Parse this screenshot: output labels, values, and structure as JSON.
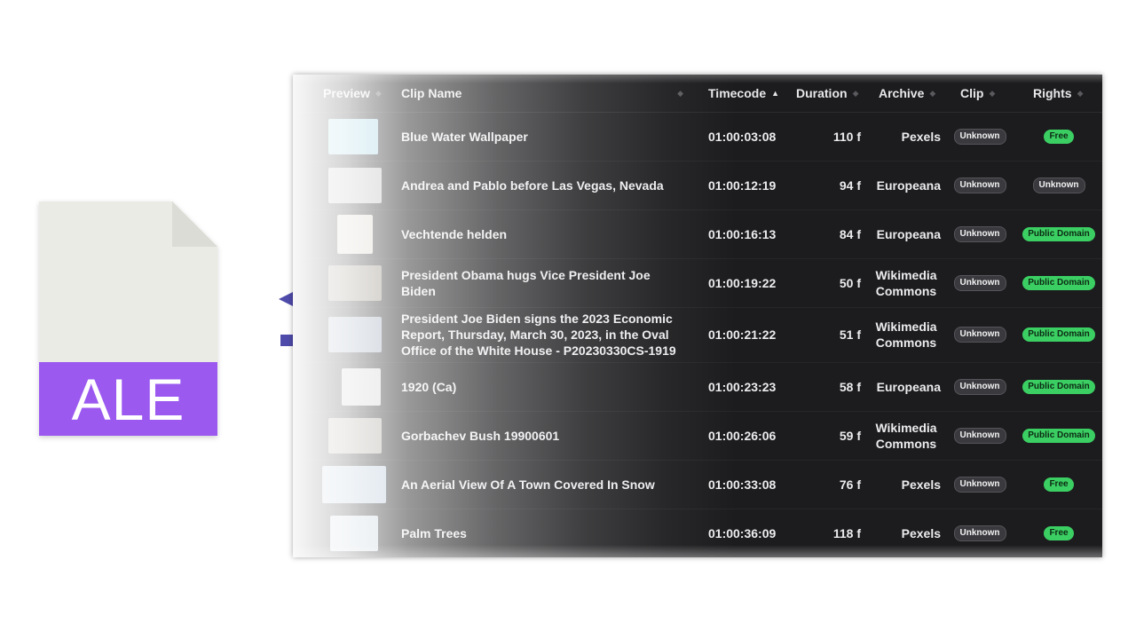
{
  "file_icon": {
    "label": "ALE",
    "body_color": "#ebebe6",
    "fold_color": "#dcdcd6",
    "band_color": "#9b59f0"
  },
  "arrows": {
    "color": "#4f4bab",
    "left": "arrow-left-icon",
    "right": "arrow-right-icon"
  },
  "table": {
    "columns": [
      {
        "label": "Preview",
        "sort": "none"
      },
      {
        "label": "Clip Name",
        "sort": "none"
      },
      {
        "label": "Timecode",
        "sort": "asc"
      },
      {
        "label": "Duration",
        "sort": "none"
      },
      {
        "label": "Archive",
        "sort": "none"
      },
      {
        "label": "Clip",
        "sort": "none"
      },
      {
        "label": "Rights",
        "sort": "none"
      }
    ],
    "rows": [
      {
        "name": "Blue Water Wallpaper",
        "timecode": "01:00:03:08",
        "duration": "110 f",
        "archive": "Pexels",
        "clip": "Unknown",
        "rights": "Free",
        "rights_kind": "free",
        "thumb_color": "#9fd2e2"
      },
      {
        "name": "Andrea and Pablo before Las Vegas, Nevada",
        "timecode": "01:00:12:19",
        "duration": "94 f",
        "archive": "Europeana",
        "clip": "Unknown",
        "rights": "Unknown",
        "rights_kind": "unknown",
        "thumb_color": "#b9b9b9"
      },
      {
        "name": "Vechtende helden",
        "timecode": "01:00:16:13",
        "duration": "84 f",
        "archive": "Europeana",
        "clip": "Unknown",
        "rights": "Public Domain",
        "rights_kind": "pd",
        "thumb_color": "#d7d2c8"
      },
      {
        "name": "President Obama hugs Vice President Joe Biden",
        "timecode": "01:00:19:22",
        "duration": "50 f",
        "archive": "Wikimedia Commons",
        "clip": "Unknown",
        "rights": "Public Domain",
        "rights_kind": "pd",
        "thumb_color": "#8e8678"
      },
      {
        "name": "President Joe Biden signs the 2023 Economic Report, Thursday, March 30, 2023, in the Oval Office of the White House - P20230330CS-1919",
        "timecode": "01:00:21:22",
        "duration": "51 f",
        "archive": "Wikimedia Commons",
        "clip": "Unknown",
        "rights": "Public Domain",
        "rights_kind": "pd",
        "thumb_color": "#9aa7b8"
      },
      {
        "name": "1920 (Ca)",
        "timecode": "01:00:23:23",
        "duration": "58 f",
        "archive": "Europeana",
        "clip": "Unknown",
        "rights": "Public Domain",
        "rights_kind": "pd",
        "thumb_color": "#cfcfcf"
      },
      {
        "name": "Gorbachev Bush 19900601",
        "timecode": "01:00:26:06",
        "duration": "59 f",
        "archive": "Wikimedia Commons",
        "clip": "Unknown",
        "rights": "Public Domain",
        "rights_kind": "pd",
        "thumb_color": "#a9a39a"
      },
      {
        "name": "An Aerial View Of A Town Covered In Snow",
        "timecode": "01:00:33:08",
        "duration": "76 f",
        "archive": "Pexels",
        "clip": "Unknown",
        "rights": "Free",
        "rights_kind": "free",
        "thumb_color": "#b4c6d6"
      },
      {
        "name": "Palm Trees",
        "timecode": "01:00:36:09",
        "duration": "118 f",
        "archive": "Pexels",
        "clip": "Unknown",
        "rights": "Free",
        "rights_kind": "free",
        "thumb_color": "#c7d3dc"
      }
    ]
  }
}
